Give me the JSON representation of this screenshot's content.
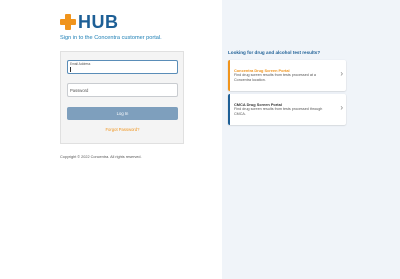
{
  "brand": {
    "logo_text": "HUB",
    "orange": "#f0941c",
    "blue": "#1d5f96"
  },
  "login": {
    "subtitle": "Sign in to the Concentra customer portal.",
    "email_label": "Email Address",
    "email_value": "",
    "password_placeholder": "Password",
    "login_button": "Log In",
    "forgot_password": "Forgot Password?",
    "copyright": "Copyright © 2022 Concentra. All rights reserved."
  },
  "drug_tests": {
    "heading": "Looking for drug and alcohol test results?",
    "cards": [
      {
        "title": "Concentra Drug Screen Portal",
        "description": "Find drug screen results from tests processed at a Concentra location.",
        "accent": "#f0941c",
        "title_color": "#f0941c"
      },
      {
        "title": "CMCA Drug Screen Portal",
        "description": "Find drug screen results from tests processed through CMCA.",
        "accent": "#1d5f96",
        "title_color": "#333333"
      }
    ]
  }
}
